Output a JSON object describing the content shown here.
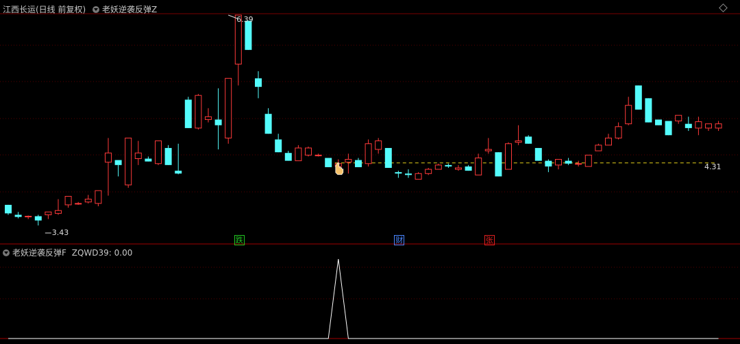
{
  "header": {
    "stock_title": "江西长运(日线 前复权)",
    "indicator_title": "老妖逆袭反弹Z"
  },
  "sub_header": {
    "indicator_title": "老妖逆袭反弹F",
    "readout": "ZQWD39: 0.00"
  },
  "events": [
    {
      "text": "跌",
      "color": "#21c521",
      "index": 23
    },
    {
      "text": "财",
      "color": "#4a86ff",
      "index": 39
    },
    {
      "text": "张",
      "color": "#e02020",
      "index": 48
    }
  ],
  "colors": {
    "up": "#ff3a3a",
    "down": "#54fcfc",
    "grid": "#5a0000",
    "level_line": "#e6d21a",
    "signal_line": "#ffffff"
  },
  "chart_data": [
    {
      "type": "candlestick",
      "title": "",
      "xlabel": "",
      "ylabel": "",
      "ylim": [
        3.3,
        6.6
      ],
      "grid": true,
      "annotations": [
        {
          "label": "6.39",
          "index": 22,
          "value": 6.39
        },
        {
          "label": "3.43",
          "index": 3,
          "value": 3.43
        },
        {
          "label": "4.31",
          "index": 69,
          "value": 4.31
        }
      ],
      "reference_line": 4.31,
      "ohlc": [
        [
          3.72,
          3.72,
          3.58,
          3.6
        ],
        [
          3.58,
          3.62,
          3.53,
          3.55
        ],
        [
          3.55,
          3.57,
          3.52,
          3.56
        ],
        [
          3.56,
          3.58,
          3.43,
          3.5
        ],
        [
          3.58,
          3.62,
          3.52,
          3.62
        ],
        [
          3.6,
          3.8,
          3.58,
          3.64
        ],
        [
          3.72,
          3.84,
          3.68,
          3.84
        ],
        [
          3.73,
          3.76,
          3.72,
          3.74
        ],
        [
          3.76,
          3.86,
          3.74,
          3.8
        ],
        [
          3.74,
          3.92,
          3.7,
          3.92
        ],
        [
          4.32,
          4.66,
          3.85,
          4.45
        ],
        [
          4.35,
          4.28,
          4.12,
          4.28
        ],
        [
          4.0,
          4.62,
          3.96,
          4.66
        ],
        [
          4.37,
          4.62,
          4.28,
          4.45
        ],
        [
          4.37,
          4.4,
          4.33,
          4.33
        ],
        [
          4.3,
          4.62,
          4.28,
          4.62
        ],
        [
          4.52,
          4.56,
          4.28,
          4.28
        ],
        [
          4.2,
          4.58,
          4.15,
          4.16
        ],
        [
          5.2,
          5.24,
          4.8,
          4.8
        ],
        [
          4.8,
          5.28,
          4.78,
          5.26
        ],
        [
          4.92,
          5.08,
          4.88,
          4.96
        ],
        [
          4.92,
          5.36,
          4.5,
          4.84
        ],
        [
          4.66,
          5.38,
          4.58,
          5.5
        ],
        [
          5.7,
          6.28,
          5.4,
          6.39
        ],
        [
          6.31,
          6.31,
          5.9,
          5.9
        ],
        [
          5.5,
          5.6,
          5.22,
          5.38
        ],
        [
          5.0,
          5.08,
          4.72,
          4.72
        ],
        [
          4.64,
          4.72,
          4.46,
          4.46
        ],
        [
          4.45,
          4.48,
          4.34,
          4.34
        ],
        [
          4.34,
          4.56,
          4.48,
          4.52
        ],
        [
          4.42,
          4.54,
          4.4,
          4.52
        ],
        [
          4.42,
          4.44,
          4.4,
          4.42
        ],
        [
          4.38,
          4.38,
          4.25,
          4.25
        ],
        [
          4.26,
          4.36,
          4.24,
          4.3
        ],
        [
          4.32,
          4.44,
          4.16,
          4.36
        ],
        [
          4.35,
          4.38,
          4.25,
          4.25
        ],
        [
          4.3,
          4.64,
          4.26,
          4.58
        ],
        [
          4.5,
          4.66,
          4.44,
          4.62
        ],
        [
          4.52,
          4.5,
          4.24,
          4.24
        ],
        [
          4.18,
          4.2,
          4.1,
          4.16
        ],
        [
          4.16,
          4.22,
          4.1,
          4.14
        ],
        [
          4.08,
          4.18,
          4.08,
          4.16
        ],
        [
          4.16,
          4.24,
          4.14,
          4.22
        ],
        [
          4.22,
          4.3,
          4.22,
          4.28
        ],
        [
          4.28,
          4.3,
          4.24,
          4.26
        ],
        [
          4.22,
          4.28,
          4.2,
          4.24
        ],
        [
          4.26,
          4.28,
          4.2,
          4.2
        ],
        [
          4.14,
          4.44,
          4.14,
          4.38
        ],
        [
          4.48,
          4.66,
          4.44,
          4.5
        ],
        [
          4.46,
          4.46,
          4.12,
          4.12
        ],
        [
          4.22,
          4.6,
          4.22,
          4.58
        ],
        [
          4.6,
          4.84,
          4.56,
          4.62
        ],
        [
          4.68,
          4.7,
          4.58,
          4.58
        ],
        [
          4.52,
          4.52,
          4.34,
          4.34
        ],
        [
          4.34,
          4.36,
          4.18,
          4.26
        ],
        [
          4.28,
          4.36,
          4.22,
          4.36
        ],
        [
          4.34,
          4.38,
          4.28,
          4.3
        ],
        [
          4.3,
          4.34,
          4.26,
          4.3
        ],
        [
          4.26,
          4.42,
          4.26,
          4.42
        ],
        [
          4.48,
          4.58,
          4.48,
          4.56
        ],
        [
          4.56,
          4.72,
          4.58,
          4.66
        ],
        [
          4.66,
          4.88,
          4.64,
          4.82
        ],
        [
          4.86,
          5.24,
          4.84,
          5.12
        ],
        [
          5.4,
          5.4,
          5.06,
          5.06
        ],
        [
          5.22,
          5.22,
          4.88,
          4.88
        ],
        [
          4.92,
          4.92,
          4.84,
          4.84
        ],
        [
          4.9,
          4.9,
          4.7,
          4.7
        ],
        [
          4.9,
          4.98,
          4.86,
          4.98
        ],
        [
          4.86,
          4.96,
          4.76,
          4.8
        ],
        [
          4.8,
          4.96,
          4.7,
          4.89
        ],
        [
          4.8,
          4.86,
          4.76,
          4.86
        ],
        [
          4.8,
          4.9,
          4.76,
          4.86
        ]
      ]
    },
    {
      "type": "line",
      "title": "",
      "series": [
        {
          "values": [
            0,
            0,
            0,
            0,
            0,
            0,
            0,
            0,
            0,
            0,
            0,
            0,
            0,
            0,
            0,
            0,
            0,
            0,
            0,
            0,
            0,
            0,
            0,
            0,
            0,
            0,
            0,
            0,
            0,
            0,
            0,
            0,
            0,
            1,
            0,
            0,
            0,
            0,
            0,
            0,
            0,
            0,
            0,
            0,
            0,
            0,
            0,
            0,
            0,
            0,
            0,
            0,
            0,
            0,
            0,
            0,
            0,
            0,
            0,
            0,
            0,
            0,
            0,
            0,
            0,
            0,
            0,
            0,
            0,
            0,
            0,
            0
          ]
        }
      ],
      "ylim": [
        0,
        1
      ]
    }
  ]
}
